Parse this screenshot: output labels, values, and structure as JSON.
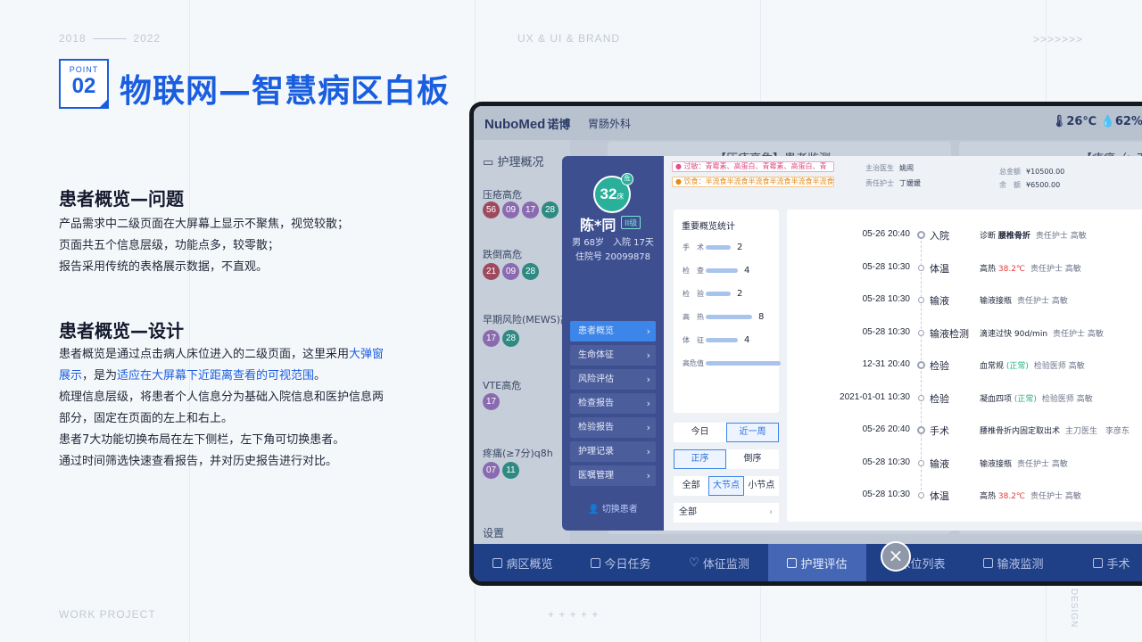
{
  "header": {
    "years_start": "2018",
    "years_end": "2022",
    "center_tag": "UX &  UI & BRAND",
    "arrows": ">>>>>>>"
  },
  "point": {
    "label": "POINT",
    "number": "02"
  },
  "title": "物联网—智慧病区白板",
  "problem": {
    "title": "患者概览—问题",
    "lines": [
      "产品需求中二级页面在大屏幕上显示不聚焦，视觉较散；",
      "页面共五个信息层级，功能点多，较零散；",
      "报告采用传统的表格展示数据，不直观。"
    ]
  },
  "design": {
    "title": "患者概览—设计",
    "p1_a": "患者概览是通过点击病人床位进入的二级页面，这里采用",
    "p1_hl1": "大弹窗展示",
    "p1_b": "，是为",
    "p1_hl2": "适应在大屏幕下近距离查看的可视范围",
    "p1_c": "。",
    "lines": [
      "梳理信息层级，将患者个人信息分为基础入院信息和医护信息两部分，固定在页面的左上和右上。",
      "患者7大功能切换布局在左下侧栏，左下角可切换患者。",
      "通过时间筛选快速查看报告，并对历史报告进行对比。"
    ]
  },
  "footer": {
    "left": "WORK PROJECT",
    "center": "+ + + + +",
    "right": "DESIGN"
  },
  "app": {
    "brand": "NuboMed",
    "brand_cn": "诺博",
    "dept": "胃肠外科",
    "temp": "26℃",
    "humidity": "62%",
    "bg_sidebar_title": "护理概况",
    "bg_sections": [
      {
        "label": "压疮高危",
        "beds": [
          "56",
          "09",
          "17",
          "28"
        ]
      },
      {
        "label": "跌倒高危",
        "beds": [
          "21",
          "09",
          "28"
        ]
      },
      {
        "label": "早期风险(MEWS)高",
        "beds": [
          "17",
          "28"
        ]
      },
      {
        "label": "VTE高危",
        "beds": [
          "17"
        ]
      },
      {
        "label": "疼痛(≥7分)q8h",
        "beds": [
          "07",
          "11"
        ]
      }
    ],
    "bg_settings": "设置",
    "bg_title_1": "【压疮高危】患者监测",
    "bg_title_2": "【疼痛（≥7分",
    "tabs": [
      "病区概览",
      "今日任务",
      "体征监测",
      "护理评估",
      "床位列表",
      "输液监测",
      "手术"
    ],
    "active_tab": "护理评估"
  },
  "patient": {
    "bed": "32",
    "bed_unit": "床",
    "badge": "危",
    "name": "陈*同",
    "level": "II级",
    "gender_age": "男 68岁",
    "days": "入院 17天",
    "admission_no": "住院号 20099878",
    "menu": [
      "患者概览",
      "生命体征",
      "风险评估",
      "检查报告",
      "检验报告",
      "护理记录",
      "医嘱管理"
    ],
    "switch_label": "切换患者",
    "allergy": "● 过敏：青霉素、高蛋白、青霉素、高蛋白、青",
    "diet": "● 饮食：半流食半流食半流食半流食半流食半流食半",
    "attending_label": "主治医生",
    "attending": "姚闹",
    "nurse_label": "责任护士",
    "nurse": "丁媛媛",
    "total_label": "总金额",
    "total": "¥10500.00",
    "balance_label": "余　额",
    "balance": "¥6500.00"
  },
  "stats": {
    "title": "重要概览统计",
    "items": [
      {
        "label": "手　术",
        "value": 2
      },
      {
        "label": "检　查",
        "value": 4
      },
      {
        "label": "检　验",
        "value": 2
      },
      {
        "label": "高　热",
        "value": 8
      },
      {
        "label": "体　征",
        "value": 4
      },
      {
        "label": "高危值",
        "value": 16
      }
    ]
  },
  "filters": {
    "range": [
      "今日",
      "近一周"
    ],
    "range_active": "近一周",
    "order": [
      "正序",
      "倒序"
    ],
    "order_active": "正序",
    "level": [
      "全部",
      "大节点",
      "小节点"
    ],
    "level_active": "大节点",
    "select": "全部"
  },
  "timeline": [
    {
      "date": "05-26  20:40",
      "big": true,
      "type": "入院",
      "detail": "诊断",
      "bold": "腰椎骨折",
      "extra": "责任护士 高敏"
    },
    {
      "date": "05-28  10:30",
      "big": false,
      "type": "体温",
      "detail": "高热",
      "red": "38.2℃",
      "extra": "责任护士 高敏"
    },
    {
      "date": "05-28  10:30",
      "big": false,
      "type": "输液",
      "detail": "输液接瓶",
      "extra": "责任护士 高敏"
    },
    {
      "date": "05-28  10:30",
      "big": false,
      "type": "输液检测",
      "detail": "滴速过快 90d/min",
      "extra": "责任护士 高敏"
    },
    {
      "date": "12-31  20:40",
      "big": true,
      "type": "检验",
      "detail": "血常规",
      "green": "(正常)",
      "extra": "检验医师 高敏"
    },
    {
      "date": "2021-01-01  10:30",
      "big": false,
      "type": "检验",
      "detail": "凝血四项",
      "green": "(正常)",
      "extra": "检验医师 高敏"
    },
    {
      "date": "05-26  20:40",
      "big": true,
      "type": "手术",
      "detail": "腰椎骨折内固定取出术",
      "extra": "主刀医生　李彦东"
    },
    {
      "date": "05-28  10:30",
      "big": false,
      "type": "输液",
      "detail": "输液接瓶",
      "extra": "责任护士 高敏"
    },
    {
      "date": "05-28  10:30",
      "big": false,
      "type": "体温",
      "detail": "高热",
      "red": "38.2℃",
      "extra": "责任护士 高敏"
    }
  ],
  "close_icon": "×"
}
